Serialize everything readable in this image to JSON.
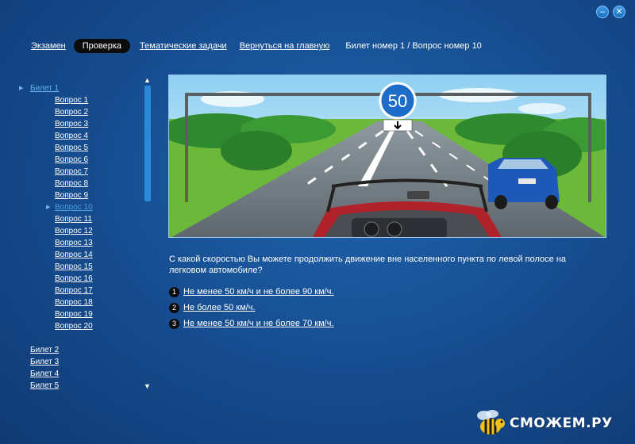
{
  "window": {
    "minimize": "–",
    "close": "✕"
  },
  "nav": {
    "exam": "Экзамен",
    "check": "Проверка",
    "topics": "Тематические задачи",
    "home": "Вернуться на главную",
    "breadcrumb": "Билет номер 1 / Вопрос номер 10"
  },
  "sidebar": {
    "tickets_top": [
      "Билет 1"
    ],
    "questions": [
      "Вопрос 1",
      "Вопрос 2",
      "Вопрос 3",
      "Вопрос 4",
      "Вопрос 5",
      "Вопрос 6",
      "Вопрос 7",
      "Вопрос 8",
      "Вопрос 9",
      "Вопрос 10",
      "Вопрос 11",
      "Вопрос 12",
      "Вопрос 13",
      "Вопрос 14",
      "Вопрос 15",
      "Вопрос 16",
      "Вопрос 17",
      "Вопрос 18",
      "Вопрос 19",
      "Вопрос 20"
    ],
    "active_question": 10,
    "tickets_bottom": [
      "Билет 2",
      "Билет 3",
      "Билет 4",
      "Билет 5"
    ],
    "scroll_up": "▲",
    "scroll_down": "▼"
  },
  "scene": {
    "speed_sign": "50"
  },
  "question": {
    "text": "С какой скоростью Вы можете продолжить движение вне населенного пункта по левой полосе на легковом автомобиле?",
    "answers": [
      {
        "num": "1",
        "text": "Не менее 50 км/ч и не более 90 км/ч."
      },
      {
        "num": "2",
        "text": "Не более 50 км/ч."
      },
      {
        "num": "3",
        "text": "Не менее 50 км/ч и не более 70 км/ч."
      }
    ]
  },
  "watermark": {
    "text": "СМОЖЕМ.РУ"
  },
  "colors": {
    "background": "#174f93",
    "accent": "#2a8ad9",
    "active_link": "#4a9ee0",
    "pill": "#0b0b0b"
  }
}
